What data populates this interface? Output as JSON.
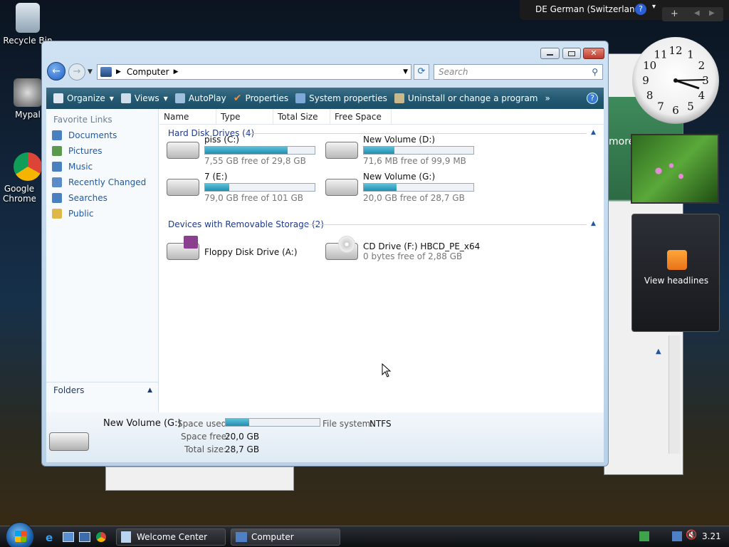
{
  "desktop": {
    "icons": [
      {
        "label": "Recycle Bin"
      },
      {
        "label": "Mypal"
      },
      {
        "label": "Google Chrome"
      }
    ]
  },
  "language_bar": {
    "text": "DE German (Switzerland)"
  },
  "gadgets": {
    "rss_label": "View headlines",
    "clock_numerals": [
      "12",
      "1",
      "2",
      "3",
      "4",
      "5",
      "6",
      "7",
      "8",
      "9",
      "10",
      "11"
    ]
  },
  "window": {
    "address": {
      "location": "Computer"
    },
    "search": {
      "placeholder": "Search"
    },
    "toolbar": {
      "organize": "Organize",
      "views": "Views",
      "autoplay": "AutoPlay",
      "properties": "Properties",
      "system_properties": "System properties",
      "uninstall": "Uninstall or change a program",
      "more": "»"
    },
    "nav": {
      "favorite_links_title": "Favorite Links",
      "items": [
        {
          "label": "Documents",
          "icon": "documents-icon"
        },
        {
          "label": "Pictures",
          "icon": "pictures-icon"
        },
        {
          "label": "Music",
          "icon": "music-icon"
        },
        {
          "label": "Recently Changed",
          "icon": "recently-changed-icon"
        },
        {
          "label": "Searches",
          "icon": "searches-icon"
        },
        {
          "label": "Public",
          "icon": "folder-icon"
        }
      ],
      "folders_label": "Folders"
    },
    "columns": [
      "Name",
      "Type",
      "Total Size",
      "Free Space"
    ],
    "groups": {
      "hard_disks": "Hard Disk Drives (4)",
      "removable": "Devices with Removable Storage (2)"
    },
    "hard_disks": [
      {
        "name": "piss (C:)",
        "free": "7,55 GB free of 29,8 GB",
        "used_fraction": 0.75
      },
      {
        "name": "New Volume (D:)",
        "free": "71,6 MB free of 99,9 MB",
        "used_fraction": 0.28
      },
      {
        "name": "7 (E:)",
        "free": "79,0 GB free of 101 GB",
        "used_fraction": 0.22
      },
      {
        "name": "New Volume (G:)",
        "free": "20,0 GB free of 28,7 GB",
        "used_fraction": 0.3
      }
    ],
    "removable": [
      {
        "name": "Floppy Disk Drive (A:)"
      },
      {
        "name": "CD Drive (F:) HBCD_PE_x64",
        "free": "0 bytes free of 2,88 GB"
      }
    ],
    "details": {
      "name": "New Volume (G:)",
      "space_used_label": "Space used:",
      "space_used_fraction": 0.25,
      "space_free_label": "Space free:",
      "space_free_value": "20,0 GB",
      "total_size_label": "Total size:",
      "total_size_value": "28,7 GB",
      "fs_label": "File system:",
      "fs_value": "NTFS"
    }
  },
  "taskbar": {
    "buttons": [
      "Welcome Center",
      "Computer"
    ],
    "time": "3.21"
  },
  "background_window": {
    "partial_text": "more"
  }
}
